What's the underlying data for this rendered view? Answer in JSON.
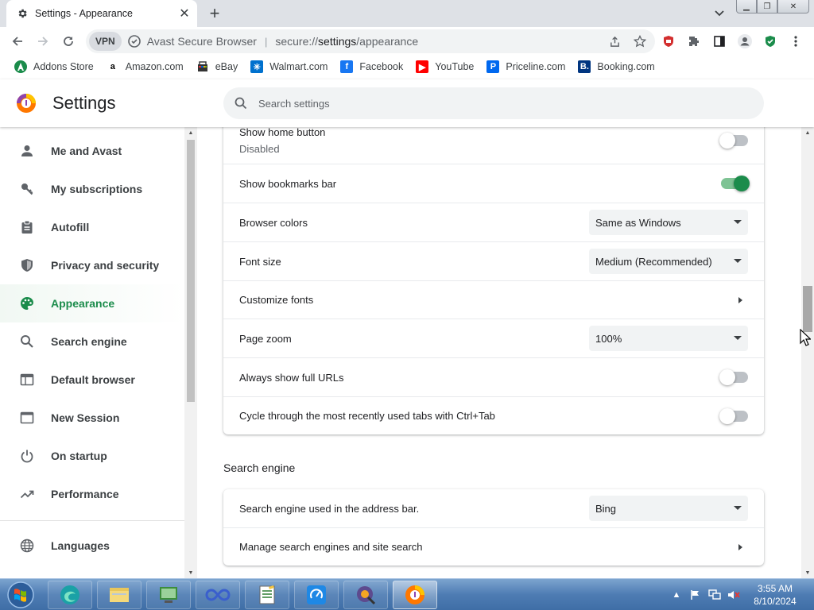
{
  "tab": {
    "title": "Settings - Appearance",
    "close": "✕",
    "new_tab": "+"
  },
  "toolbar": {
    "vpn": "VPN",
    "product": "Avast Secure Browser",
    "separator": "|",
    "url_scheme": "secure://",
    "url_host": "settings",
    "url_path": "/appearance"
  },
  "bookmarks": [
    {
      "label": "Addons Store",
      "icon": "avast-icon",
      "color": "#1b8c4b",
      "glyph": "a"
    },
    {
      "label": "Amazon.com",
      "icon": "amazon-icon",
      "color": "#ffffff",
      "glyph": "a"
    },
    {
      "label": "eBay",
      "icon": "ebay-icon",
      "color": "#ffffff",
      "glyph": ""
    },
    {
      "label": "Walmart.com",
      "icon": "walmart-icon",
      "color": "#0071ce",
      "glyph": "✳"
    },
    {
      "label": "Facebook",
      "icon": "facebook-icon",
      "color": "#1877f2",
      "glyph": "f"
    },
    {
      "label": "YouTube",
      "icon": "youtube-icon",
      "color": "#ff0000",
      "glyph": "▶"
    },
    {
      "label": "Priceline.com",
      "icon": "priceline-icon",
      "color": "#0068ef",
      "glyph": "P"
    },
    {
      "label": "Booking.com",
      "icon": "booking-icon",
      "color": "#003580",
      "glyph": "B."
    }
  ],
  "settings": {
    "title": "Settings",
    "search_placeholder": "Search settings"
  },
  "sidebar": {
    "items": [
      {
        "label": "Me and Avast",
        "icon": "person-icon"
      },
      {
        "label": "My subscriptions",
        "icon": "key-icon"
      },
      {
        "label": "Autofill",
        "icon": "clipboard-icon"
      },
      {
        "label": "Privacy and security",
        "icon": "shield-icon"
      },
      {
        "label": "Appearance",
        "icon": "palette-icon",
        "active": true
      },
      {
        "label": "Search engine",
        "icon": "search-icon"
      },
      {
        "label": "Default browser",
        "icon": "browser-icon"
      },
      {
        "label": "New Session",
        "icon": "window-icon"
      },
      {
        "label": "On startup",
        "icon": "power-icon"
      },
      {
        "label": "Performance",
        "icon": "trend-icon"
      },
      {
        "label": "Languages",
        "icon": "globe-icon"
      }
    ]
  },
  "appearance": {
    "home_button": {
      "label": "Show home button",
      "sublabel": "Disabled",
      "enabled": false
    },
    "bookmarks_bar": {
      "label": "Show bookmarks bar",
      "enabled": true
    },
    "browser_colors": {
      "label": "Browser colors",
      "value": "Same as Windows"
    },
    "font_size": {
      "label": "Font size",
      "value": "Medium (Recommended)"
    },
    "customize_fonts": {
      "label": "Customize fonts"
    },
    "page_zoom": {
      "label": "Page zoom",
      "value": "100%"
    },
    "full_urls": {
      "label": "Always show full URLs",
      "enabled": false
    },
    "cycle_tabs": {
      "label": "Cycle through the most recently used tabs with Ctrl+Tab",
      "enabled": false
    }
  },
  "search_engine": {
    "heading": "Search engine",
    "engine": {
      "label": "Search engine used in the address bar.",
      "value": "Bing"
    },
    "manage": {
      "label": "Manage search engines and site search"
    }
  },
  "taskbar": {
    "time": "3:55 AM",
    "date": "8/10/2024"
  },
  "colors": {
    "accent": "#1b8c4b",
    "toggle_on_track": "#7ec394",
    "toggle_off_track": "#bdc1c6"
  }
}
